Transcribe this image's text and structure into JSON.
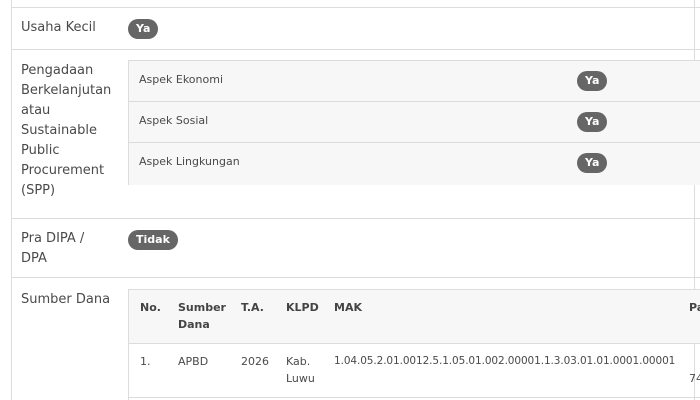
{
  "usaha_kecil": {
    "label": "Usaha Kecil",
    "badge": "Ya"
  },
  "spp": {
    "label_lines": [
      "Pengadaan",
      "Berkelanjutan",
      "atau",
      "Sustainable",
      "Public",
      "Procurement",
      "(SPP)"
    ],
    "aspects": [
      {
        "label": "Aspek Ekonomi",
        "badge": "Ya"
      },
      {
        "label": "Aspek Sosial",
        "badge": "Ya"
      },
      {
        "label": "Aspek Lingkungan",
        "badge": "Ya"
      }
    ]
  },
  "pra_dipa": {
    "label_lines": [
      "Pra DIPA /",
      "DPA"
    ],
    "badge": "Tidak"
  },
  "sumber_dana": {
    "label": "Sumber Dana",
    "headers": {
      "no": "No.",
      "sumber_dana_lines": [
        "Sumber",
        "Dana"
      ],
      "ta": "T.A.",
      "klpd": "KLPD",
      "mak": "MAK",
      "truncated": "Pa"
    },
    "rows": [
      {
        "no": "1.",
        "sumber_dana": "APBD",
        "ta": "2026",
        "klpd_lines": [
          "Kab.",
          "Luwu"
        ],
        "mak": "1.04.05.2.01.0012.5.1.05.01.002.00001.1.3.03.01.01.0001.00001",
        "truncated": "74"
      }
    ]
  },
  "colors": {
    "badge_bg": "#666666",
    "badge_text": "#ffffff",
    "border": "#dcdcdc",
    "cell_bg": "#f7f7f7"
  }
}
